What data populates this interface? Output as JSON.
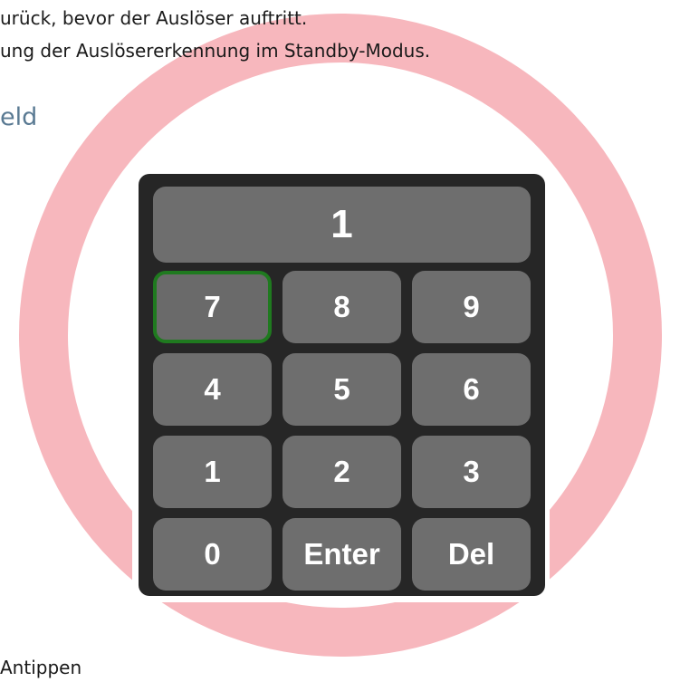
{
  "document": {
    "line_1": "urück, bevor der Auslöser auftritt.",
    "line_2": "ung der Auslösererkennung im Standby-Modus.",
    "heading": "eld",
    "bottom_line": "Antippen"
  },
  "watermark": {
    "shape": "circle-outline",
    "color": "#f7b7bd"
  },
  "keypad": {
    "display_value": "1",
    "focused_key": "7",
    "focus_color": "#1f7a1f",
    "key_color": "#6e6e6e",
    "background_color": "#262626",
    "keys": {
      "k7": "7",
      "k8": "8",
      "k9": "9",
      "k4": "4",
      "k5": "5",
      "k6": "6",
      "k1": "1",
      "k2": "2",
      "k3": "3",
      "k0": "0",
      "enter": "Enter",
      "del": "Del"
    }
  }
}
